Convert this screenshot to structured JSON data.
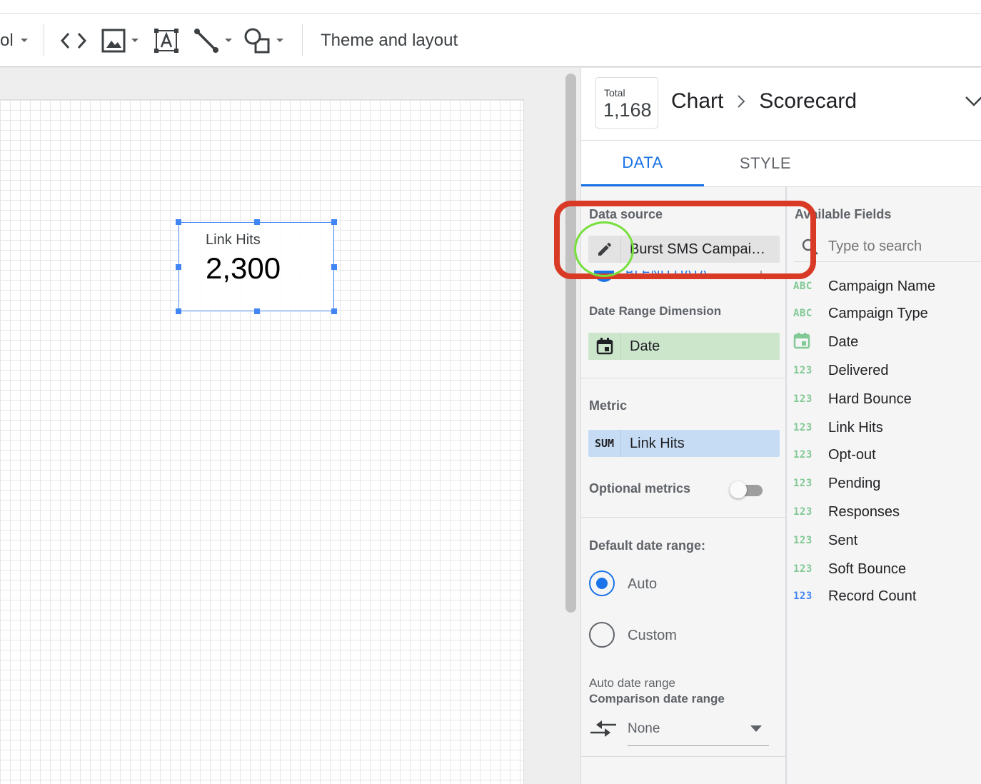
{
  "toolbar": {
    "cut_label": "ol",
    "theme_label": "Theme and layout",
    "icons": [
      "code-embed-icon",
      "image-icon",
      "text-box-icon",
      "line-icon",
      "shape-icon"
    ]
  },
  "canvas": {
    "scorecard": {
      "label": "Link Hits",
      "value": "2,300"
    }
  },
  "panel": {
    "total_label": "Total",
    "total_value": "1,168",
    "breadcrumb": [
      "Chart",
      "Scorecard"
    ],
    "tabs": [
      {
        "label": "DATA",
        "active": true
      },
      {
        "label": "STYLE",
        "active": false
      }
    ],
    "data": {
      "data_source_title": "Data source",
      "data_source_name": "Burst SMS Campai…",
      "blend_label": "BLEND DATA",
      "date_range_title": "Date Range Dimension",
      "date_range_value": "Date",
      "metric_title": "Metric",
      "metric_agg": "SUM",
      "metric_value": "Link Hits",
      "optional_metrics_label": "Optional metrics",
      "default_date_title": "Default date range:",
      "radio_auto": "Auto",
      "radio_custom": "Custom",
      "auto_date_label": "Auto date range",
      "comparison_title": "Comparison date range",
      "comparison_value": "None"
    },
    "fields": {
      "title": "Available Fields",
      "search_placeholder": "Type to search",
      "items": [
        {
          "type": "ABC",
          "name": "Campaign Name"
        },
        {
          "type": "ABC",
          "name": "Campaign Type"
        },
        {
          "type": "DATE",
          "name": "Date"
        },
        {
          "type": "123",
          "name": "Delivered"
        },
        {
          "type": "123",
          "name": "Hard Bounce"
        },
        {
          "type": "123",
          "name": "Link Hits"
        },
        {
          "type": "123",
          "name": "Opt-out"
        },
        {
          "type": "123",
          "name": "Pending"
        },
        {
          "type": "123",
          "name": "Responses"
        },
        {
          "type": "123",
          "name": "Sent"
        },
        {
          "type": "123",
          "name": "Soft Bounce"
        },
        {
          "type": "123",
          "name": "Record Count"
        }
      ]
    }
  },
  "colors": {
    "accent": "#1a73e8",
    "metric_chip": "#c6dcf5",
    "dimension_chip": "#cce6cc",
    "annotation_red": "#d93a26",
    "annotation_green": "#76e03c"
  }
}
